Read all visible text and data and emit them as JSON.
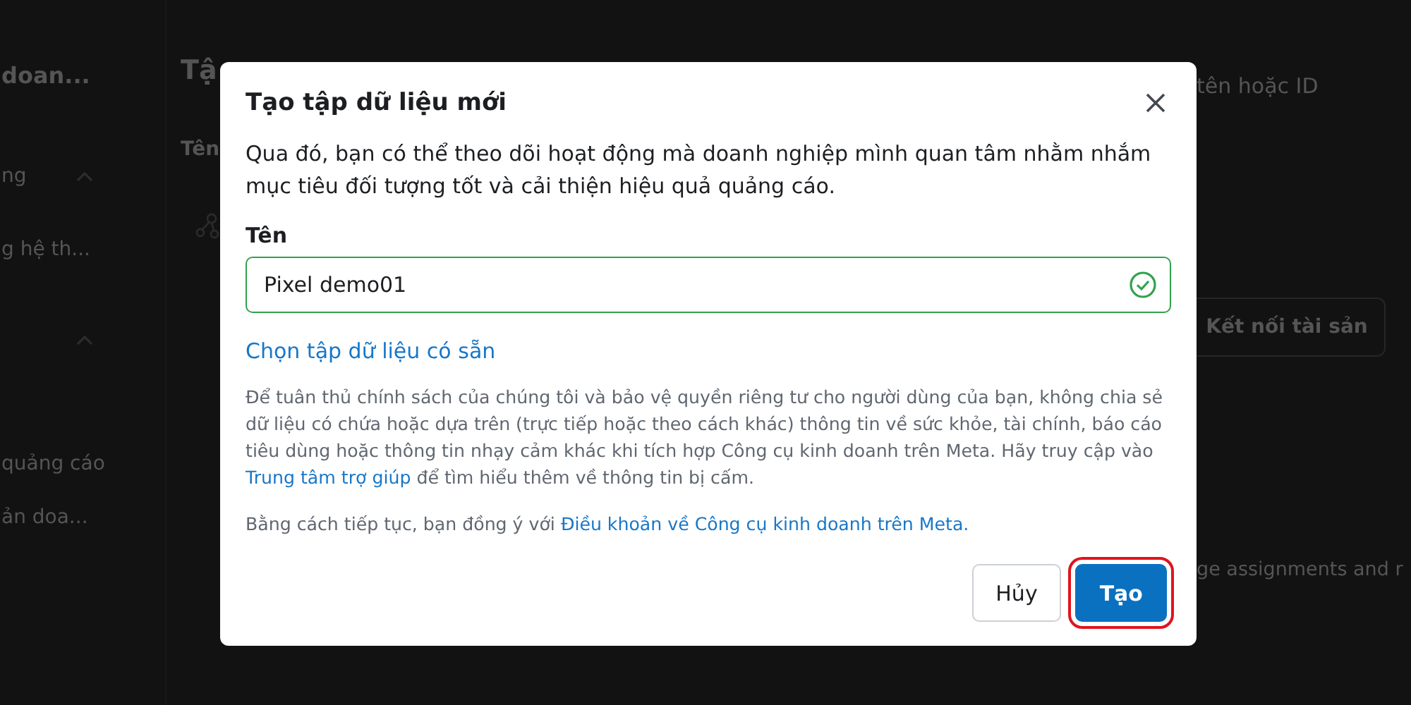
{
  "background": {
    "sidebar": [
      {
        "kind": "title",
        "text": "doan..."
      },
      {
        "kind": "section",
        "text": "ng",
        "expanded": true
      },
      {
        "kind": "item",
        "text": "g hệ th..."
      },
      {
        "kind": "toggle",
        "expanded": true
      },
      {
        "kind": "item",
        "text": "quảng cáo"
      },
      {
        "kind": "item",
        "text": "ản doa..."
      }
    ],
    "page_title": "Tậ",
    "column_header": "Tên",
    "search_placeholder": "tên hoặc ID",
    "connect_button": "Kết nối tài sản",
    "note": "ge assignments and r"
  },
  "dialog": {
    "title": "Tạo tập dữ liệu mới",
    "description": "Qua đó, bạn có thể theo dõi hoạt động mà doanh nghiệp mình quan tâm nhằm nhắm mục tiêu đối tượng tốt và cải thiện hiệu quả quảng cáo.",
    "name_label": "Tên",
    "name_value": "Pixel demo01",
    "name_valid": true,
    "existing_link": "Chọn tập dữ liệu có sẵn",
    "policy": {
      "text": "Để tuân thủ chính sách của chúng tôi và bảo vệ quyền riêng tư cho người dùng của bạn, không chia sẻ dữ liệu có chứa hoặc dựa trên (trực tiếp hoặc theo cách khác) thông tin về sức khỏe, tài chính, báo cáo tiêu dùng hoặc thông tin nhạy cảm khác khi tích hợp Công cụ kinh doanh trên Meta. Hãy truy cập vào",
      "link": "Trung tâm trợ giúp",
      "after": "để tìm hiểu thêm về thông tin bị cấm."
    },
    "terms": {
      "text": "Bằng cách tiếp tục, bạn đồng ý với",
      "link": "Điều khoản về Công cụ kinh doanh trên Meta."
    },
    "buttons": [
      {
        "kind": "secondary",
        "label": "Hủy",
        "highlighted": false
      },
      {
        "kind": "primary",
        "label": "Tạo",
        "highlighted": true
      }
    ]
  }
}
